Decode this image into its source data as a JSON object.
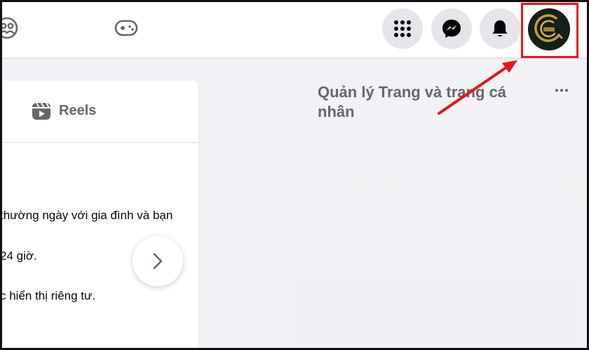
{
  "topbar": {
    "left_icons": [
      "groups-icon",
      "gaming-icon"
    ],
    "right_buttons": [
      "menu-grid-icon",
      "messenger-icon",
      "bell-icon"
    ],
    "avatar": "profile-avatar"
  },
  "stories": {
    "tab_label": "Reels",
    "lines": [
      "thường ngày với gia đình và bạn",
      "24 giờ.",
      "c hiển thị riêng tư."
    ]
  },
  "right_panel": {
    "title": "Quản lý Trang và trang cá nhân"
  },
  "annotation": {
    "highlight_color": "#e8151b"
  }
}
